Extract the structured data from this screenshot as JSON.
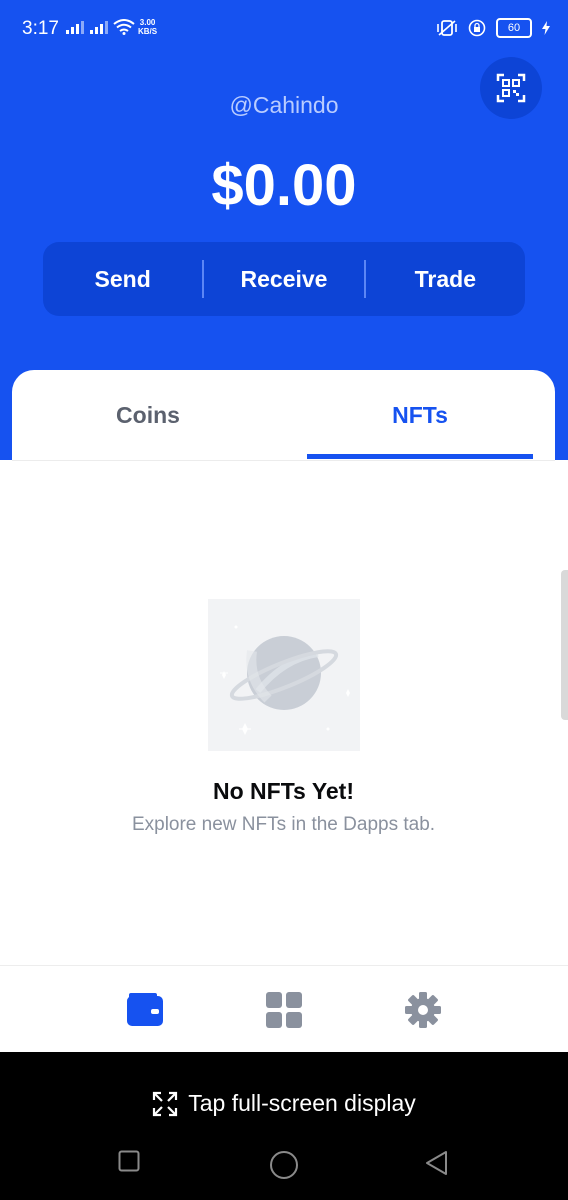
{
  "status_bar": {
    "time": "3:17",
    "net_speed_value": "3.00",
    "net_speed_unit": "KB/S",
    "battery": "60"
  },
  "header": {
    "username": "@Cahindo",
    "balance": "$0.00",
    "actions": [
      "Send",
      "Receive",
      "Trade"
    ]
  },
  "tabs": {
    "coins": "Coins",
    "nfts": "NFTs",
    "active": "NFTs"
  },
  "empty_state": {
    "title": "No NFTs Yet!",
    "subtitle": "Explore new NFTs in the Dapps tab."
  },
  "bottom_nav": {
    "items": [
      "wallet-icon",
      "dapps-grid-icon",
      "settings-gear-icon"
    ],
    "active": "wallet-icon"
  },
  "overlay": {
    "fullscreen_label": "Tap full-screen display"
  },
  "colors": {
    "brand_blue": "#1652f0",
    "button_blue": "#0d44d6",
    "inactive_gray": "#5b616e",
    "subtext_gray": "#8a919e"
  }
}
